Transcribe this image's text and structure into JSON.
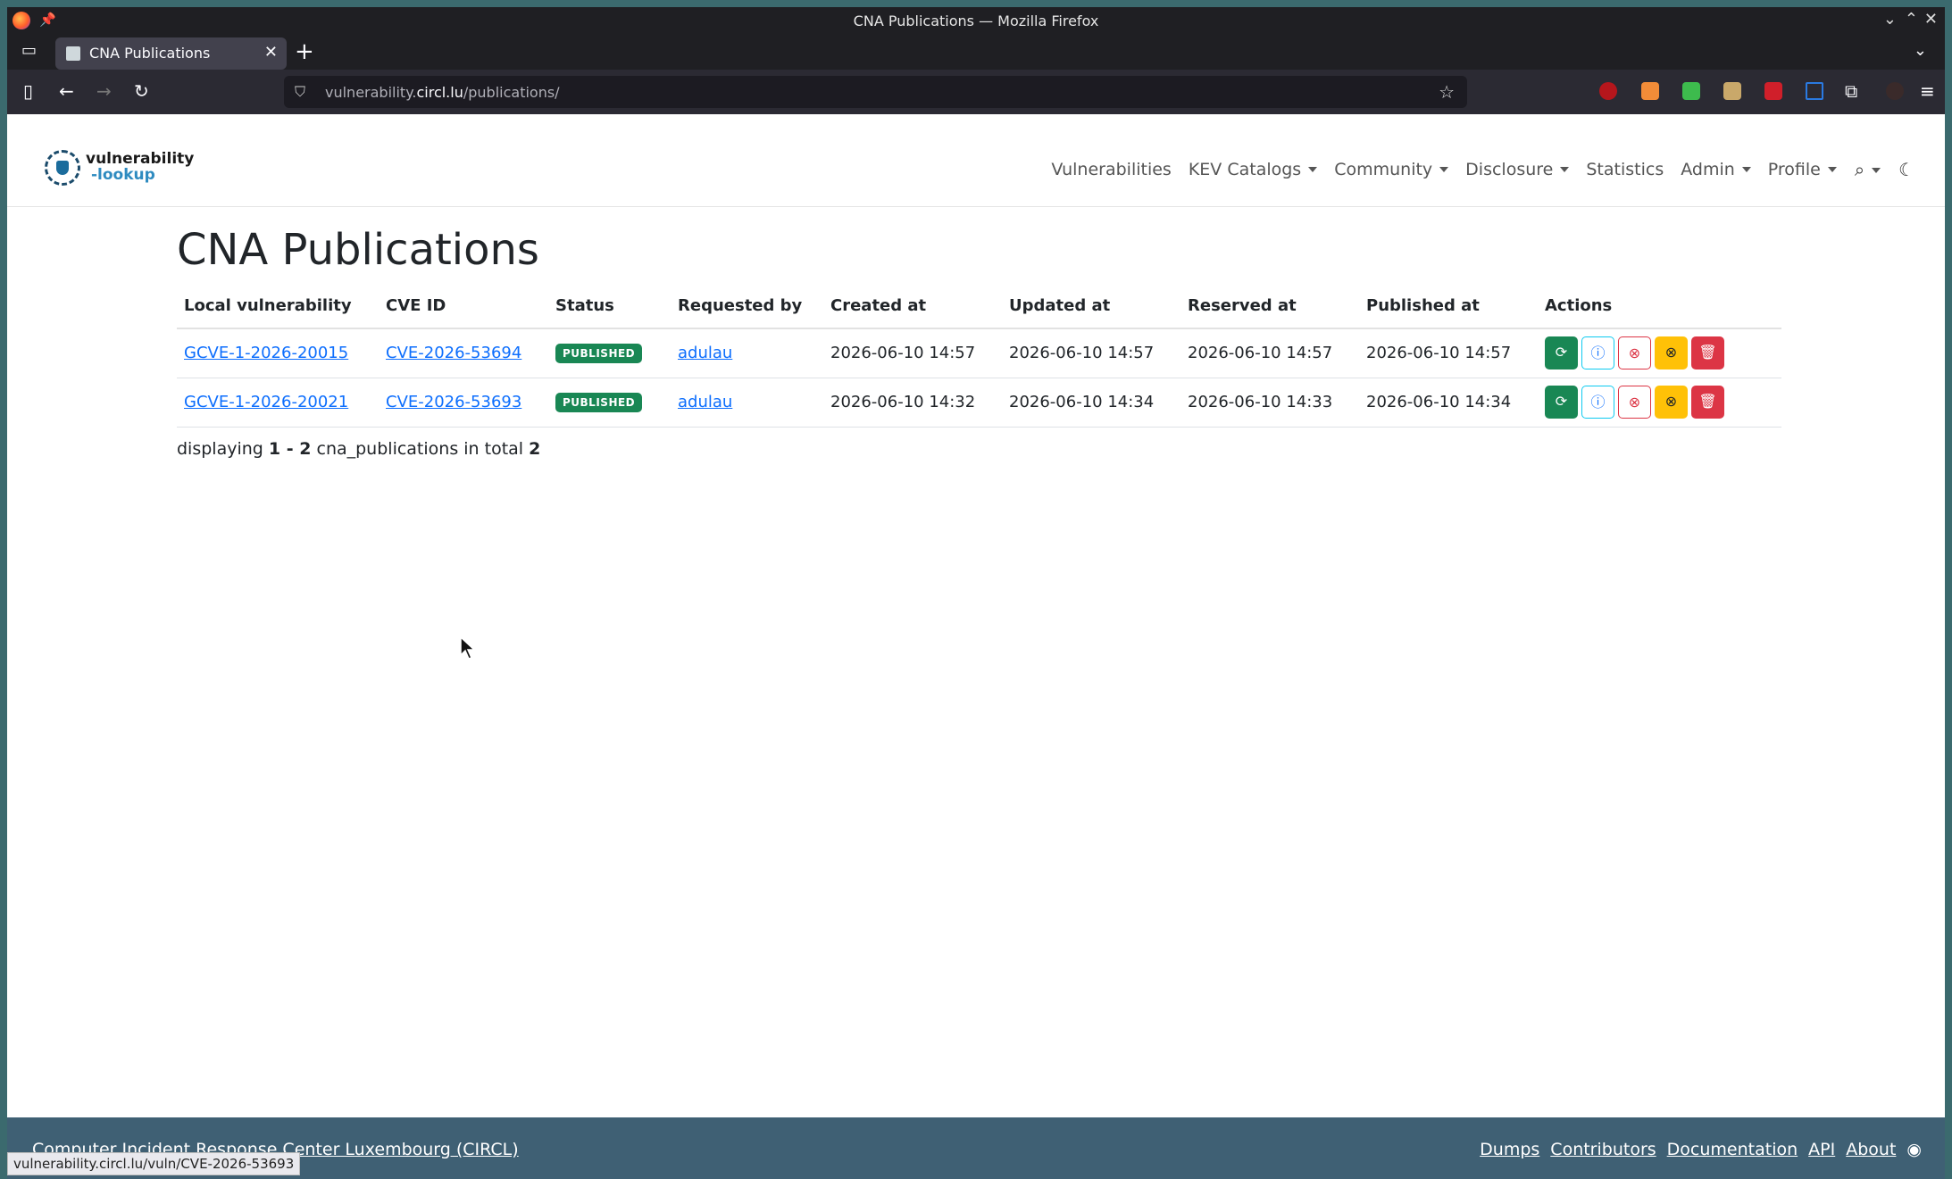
{
  "window": {
    "title": "CNA Publications — Mozilla Firefox"
  },
  "tab": {
    "label": "CNA Publications"
  },
  "urlbar": {
    "prefix": "vulnerability.",
    "host": "circl.lu",
    "path": "/publications/"
  },
  "site": {
    "logo_line1": "vulnerability",
    "logo_line2": "-lookup",
    "nav": [
      "Vulnerabilities",
      "KEV Catalogs",
      "Community",
      "Disclosure",
      "Statistics",
      "Admin",
      "Profile"
    ]
  },
  "page": {
    "title": "CNA Publications"
  },
  "table": {
    "headers": [
      "Local vulnerability",
      "CVE ID",
      "Status",
      "Requested by",
      "Created at",
      "Updated at",
      "Reserved at",
      "Published at",
      "Actions"
    ],
    "rows": [
      {
        "local": "GCVE-1-2026-20015",
        "cve": "CVE-2026-53694",
        "status": "PUBLISHED",
        "requested_by": "adulau",
        "created": "2026-06-10 14:57",
        "updated": "2026-06-10 14:57",
        "reserved": "2026-06-10 14:57",
        "published": "2026-06-10 14:57"
      },
      {
        "local": "GCVE-1-2026-20021",
        "cve": "CVE-2026-53693",
        "status": "PUBLISHED",
        "requested_by": "adulau",
        "created": "2026-06-10 14:32",
        "updated": "2026-06-10 14:34",
        "reserved": "2026-06-10 14:33",
        "published": "2026-06-10 14:34"
      }
    ]
  },
  "summary": {
    "prefix": "displaying ",
    "range": "1 - 2",
    "middle": " cna_publications in total ",
    "total": "2"
  },
  "footer": {
    "org": "Computer Incident Response Center Luxembourg (CIRCL)",
    "links": [
      "Dumps",
      "Contributors",
      "Documentation",
      "API",
      "About"
    ]
  },
  "status_url": "vulnerability.circl.lu/vuln/CVE-2026-53693",
  "colors": {
    "published_badge": "#198754",
    "footer_bg": "#3f6074",
    "link": "#0d6efd"
  }
}
